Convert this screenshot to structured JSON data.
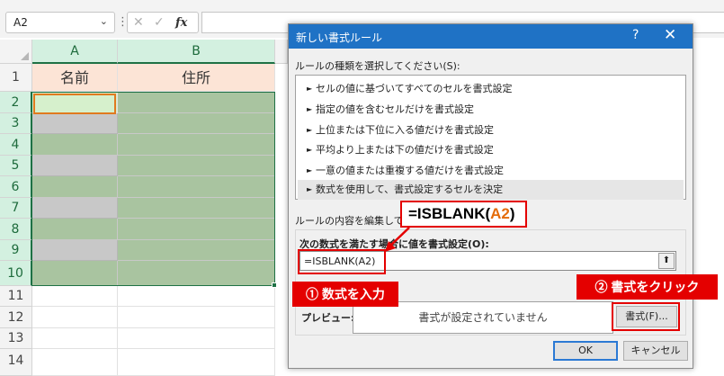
{
  "formula_bar": {
    "name_box": "A2",
    "name_box_arrow": "⌄",
    "separator": "⋮",
    "cancel_symbol": "✕",
    "enter_symbol": "✓",
    "fx_symbol": "fx",
    "formula": ""
  },
  "sheet": {
    "columns": [
      "A",
      "B"
    ],
    "rows": [
      "1",
      "2",
      "3",
      "4",
      "5",
      "6",
      "7",
      "8",
      "9",
      "10",
      "11",
      "12",
      "13",
      "14"
    ],
    "header_cells": {
      "a1": "名前",
      "b1": "住所"
    },
    "colors": {
      "header_fill": "#fce4d6",
      "green_fill": "#a9c4a0",
      "gray_fill": "#c8c8c8",
      "selection": "#1e7145",
      "active_cell": "#e07a1f"
    }
  },
  "dialog": {
    "title": "新しい書式ルール",
    "help": "?",
    "close": "✕",
    "rule_type_label": "ルールの種類を選択してください(S):",
    "rule_types": [
      "セルの値に基づいてすべてのセルを書式設定",
      "指定の値を含むセルだけを書式設定",
      "上位または下位に入る値だけを書式設定",
      "平均より上または下の値だけを書式設定",
      "一意の値または重複する値だけを書式設定",
      "数式を使用して、書式設定するセルを決定"
    ],
    "bullet": "►",
    "edit_label": "ルールの内容を編集してくだ",
    "formula_label": "次の数式を満たす場合に値を書式設定(O):",
    "formula_value": "=ISBLANK(A2)",
    "ref_button": "⬆",
    "preview_label": "プレビュー:",
    "preview_text": "書式が設定されていません",
    "format_button": "書式(F)...",
    "ok_button": "OK",
    "cancel_button": "キャンセル"
  },
  "annotations": {
    "callout_prefix": "=ISBLANK(",
    "callout_ref": "A2",
    "callout_suffix": ")",
    "step1": "① 数式を入力",
    "step2": "② 書式をクリック",
    "accent_color": "#e40000"
  }
}
